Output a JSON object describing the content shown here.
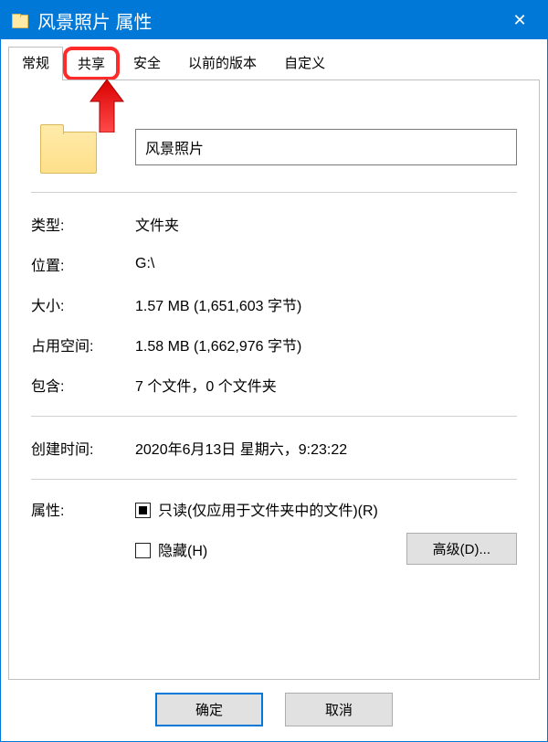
{
  "window": {
    "title": "风景照片 属性"
  },
  "tabs": {
    "general": "常规",
    "share": "共享",
    "security": "安全",
    "previous": "以前的版本",
    "customize": "自定义"
  },
  "folder": {
    "name": "风景照片"
  },
  "props": {
    "type_label": "类型:",
    "type_value": "文件夹",
    "location_label": "位置:",
    "location_value": "G:\\",
    "size_label": "大小:",
    "size_value": "1.57 MB (1,651,603 字节)",
    "disk_label": "占用空间:",
    "disk_value": "1.58 MB (1,662,976 字节)",
    "contains_label": "包含:",
    "contains_value": "7 个文件，0 个文件夹",
    "created_label": "创建时间:",
    "created_value": "2020年6月13日 星期六，9:23:22"
  },
  "attributes": {
    "label": "属性:",
    "readonly_label": "只读(仅应用于文件夹中的文件)(R)",
    "hidden_label": "隐藏(H)",
    "advanced_button": "高级(D)..."
  },
  "footer": {
    "ok": "确定",
    "cancel": "取消"
  },
  "colors": {
    "accent": "#0078d7",
    "highlight": "#ff2a2a"
  }
}
